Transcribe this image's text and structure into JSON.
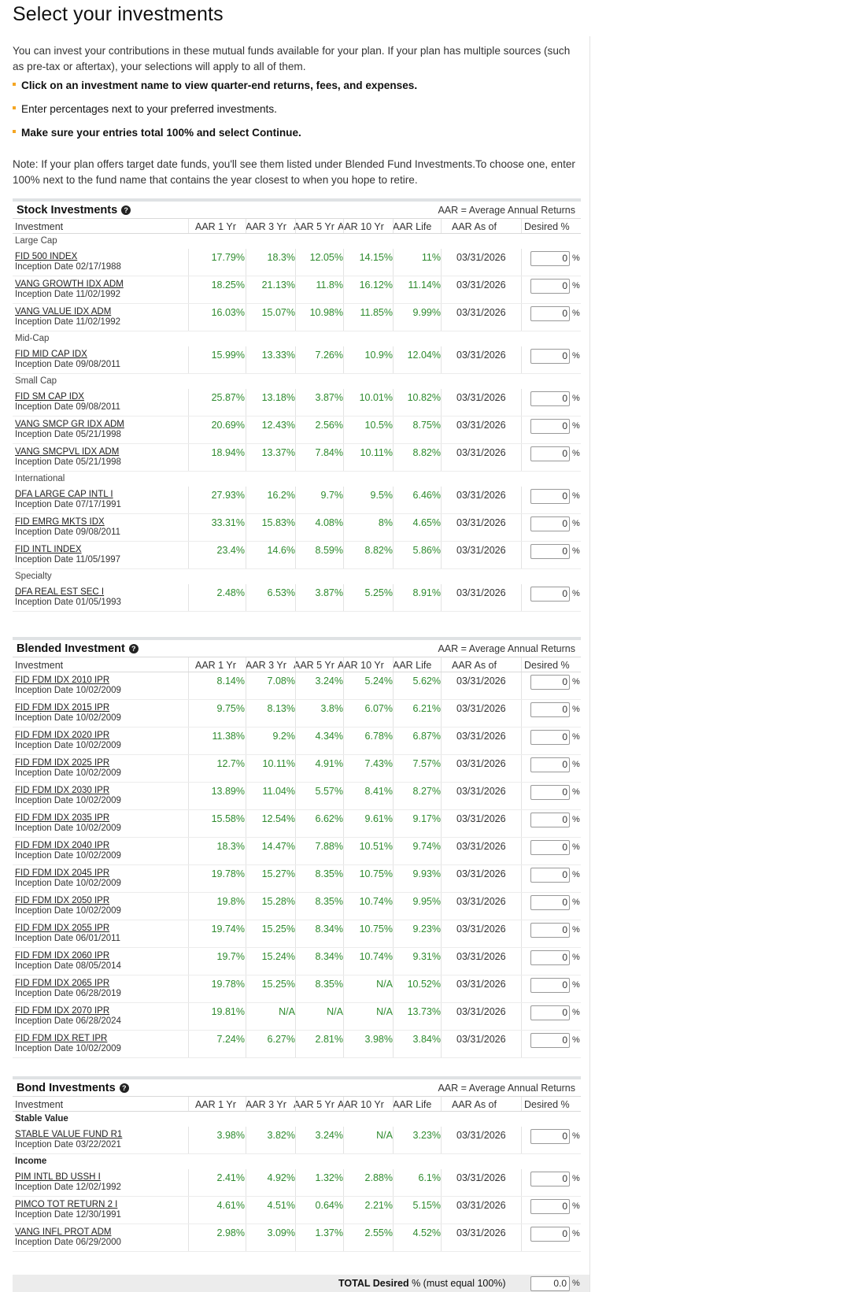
{
  "page_title": "Select your investments",
  "intro": "You can invest your contributions in these mutual funds available for your plan. If your plan has multiple sources (such as pre-tax or aftertax), your selections will apply to all of them.",
  "bullets": [
    "Click on an investment name to view quarter-end returns, fees, and expenses.",
    "Enter percentages next to your preferred investments.",
    "Make sure your entries total 100% and select Continue."
  ],
  "note": "Note: If your plan offers target date funds, you'll see them listed under Blended Fund Investments.To choose one, enter 100% next to the fund name that contains the year closest to when you hope to retire.",
  "aar_note": "AAR = Average Annual Returns",
  "columns": [
    "Investment",
    "AAR 1 Yr",
    "AAR 3 Yr",
    "AAR 5 Yr",
    "AAR 10 Yr",
    "AAR Life",
    "AAR As of",
    "Desired %"
  ],
  "percent_sign": "%",
  "sections": [
    {
      "title": "Stock Investments",
      "groups": [
        {
          "label": "Large Cap",
          "bold": false,
          "funds": [
            {
              "name": "FID 500 INDEX",
              "inception": "Inception Date 02/17/1988",
              "y1": "17.79%",
              "y3": "18.3%",
              "y5": "12.05%",
              "y10": "14.15%",
              "life": "11%",
              "asof": "03/31/2026",
              "desired": "0"
            },
            {
              "name": "VANG GROWTH IDX ADM",
              "inception": "Inception Date 11/02/1992",
              "y1": "18.25%",
              "y3": "21.13%",
              "y5": "11.8%",
              "y10": "16.12%",
              "life": "11.14%",
              "asof": "03/31/2026",
              "desired": "0"
            },
            {
              "name": "VANG VALUE IDX ADM",
              "inception": "Inception Date 11/02/1992",
              "y1": "16.03%",
              "y3": "15.07%",
              "y5": "10.98%",
              "y10": "11.85%",
              "life": "9.99%",
              "asof": "03/31/2026",
              "desired": "0"
            }
          ]
        },
        {
          "label": "Mid-Cap",
          "bold": false,
          "funds": [
            {
              "name": "FID MID CAP IDX",
              "inception": "Inception Date 09/08/2011",
              "y1": "15.99%",
              "y3": "13.33%",
              "y5": "7.26%",
              "y10": "10.9%",
              "life": "12.04%",
              "asof": "03/31/2026",
              "desired": "0"
            }
          ]
        },
        {
          "label": "Small Cap",
          "bold": false,
          "funds": [
            {
              "name": "FID SM CAP IDX",
              "inception": "Inception Date 09/08/2011",
              "y1": "25.87%",
              "y3": "13.18%",
              "y5": "3.87%",
              "y10": "10.01%",
              "life": "10.82%",
              "asof": "03/31/2026",
              "desired": "0"
            },
            {
              "name": "VANG SMCP GR IDX ADM",
              "inception": "Inception Date 05/21/1998",
              "y1": "20.69%",
              "y3": "12.43%",
              "y5": "2.56%",
              "y10": "10.5%",
              "life": "8.75%",
              "asof": "03/31/2026",
              "desired": "0"
            },
            {
              "name": "VANG SMCPVL IDX ADM",
              "inception": "Inception Date 05/21/1998",
              "y1": "18.94%",
              "y3": "13.37%",
              "y5": "7.84%",
              "y10": "10.11%",
              "life": "8.82%",
              "asof": "03/31/2026",
              "desired": "0"
            }
          ]
        },
        {
          "label": "International",
          "bold": false,
          "funds": [
            {
              "name": "DFA LARGE CAP INTL I",
              "inception": "Inception Date 07/17/1991",
              "y1": "27.93%",
              "y3": "16.2%",
              "y5": "9.7%",
              "y10": "9.5%",
              "life": "6.46%",
              "asof": "03/31/2026",
              "desired": "0"
            },
            {
              "name": "FID EMRG MKTS IDX",
              "inception": "Inception Date 09/08/2011",
              "y1": "33.31%",
              "y3": "15.83%",
              "y5": "4.08%",
              "y10": "8%",
              "life": "4.65%",
              "asof": "03/31/2026",
              "desired": "0"
            },
            {
              "name": "FID INTL INDEX",
              "inception": "Inception Date 11/05/1997",
              "y1": "23.4%",
              "y3": "14.6%",
              "y5": "8.59%",
              "y10": "8.82%",
              "life": "5.86%",
              "asof": "03/31/2026",
              "desired": "0"
            }
          ]
        },
        {
          "label": "Specialty",
          "bold": false,
          "funds": [
            {
              "name": "DFA REAL EST SEC I",
              "inception": "Inception Date 01/05/1993",
              "y1": "2.48%",
              "y3": "6.53%",
              "y5": "3.87%",
              "y10": "5.25%",
              "life": "8.91%",
              "asof": "03/31/2026",
              "desired": "0"
            }
          ]
        }
      ]
    },
    {
      "title": "Blended Investment",
      "groups": [
        {
          "label": "",
          "bold": false,
          "funds": [
            {
              "name": "FID FDM IDX 2010 IPR",
              "inception": "Inception Date 10/02/2009",
              "y1": "8.14%",
              "y3": "7.08%",
              "y5": "3.24%",
              "y10": "5.24%",
              "life": "5.62%",
              "asof": "03/31/2026",
              "desired": "0"
            },
            {
              "name": "FID FDM IDX 2015 IPR",
              "inception": "Inception Date 10/02/2009",
              "y1": "9.75%",
              "y3": "8.13%",
              "y5": "3.8%",
              "y10": "6.07%",
              "life": "6.21%",
              "asof": "03/31/2026",
              "desired": "0"
            },
            {
              "name": "FID FDM IDX 2020 IPR",
              "inception": "Inception Date 10/02/2009",
              "y1": "11.38%",
              "y3": "9.2%",
              "y5": "4.34%",
              "y10": "6.78%",
              "life": "6.87%",
              "asof": "03/31/2026",
              "desired": "0"
            },
            {
              "name": "FID FDM IDX 2025 IPR",
              "inception": "Inception Date 10/02/2009",
              "y1": "12.7%",
              "y3": "10.11%",
              "y5": "4.91%",
              "y10": "7.43%",
              "life": "7.57%",
              "asof": "03/31/2026",
              "desired": "0"
            },
            {
              "name": "FID FDM IDX 2030 IPR",
              "inception": "Inception Date 10/02/2009",
              "y1": "13.89%",
              "y3": "11.04%",
              "y5": "5.57%",
              "y10": "8.41%",
              "life": "8.27%",
              "asof": "03/31/2026",
              "desired": "0"
            },
            {
              "name": "FID FDM IDX 2035 IPR",
              "inception": "Inception Date 10/02/2009",
              "y1": "15.58%",
              "y3": "12.54%",
              "y5": "6.62%",
              "y10": "9.61%",
              "life": "9.17%",
              "asof": "03/31/2026",
              "desired": "0"
            },
            {
              "name": "FID FDM IDX 2040 IPR",
              "inception": "Inception Date 10/02/2009",
              "y1": "18.3%",
              "y3": "14.47%",
              "y5": "7.88%",
              "y10": "10.51%",
              "life": "9.74%",
              "asof": "03/31/2026",
              "desired": "0"
            },
            {
              "name": "FID FDM IDX 2045 IPR",
              "inception": "Inception Date 10/02/2009",
              "y1": "19.78%",
              "y3": "15.27%",
              "y5": "8.35%",
              "y10": "10.75%",
              "life": "9.93%",
              "asof": "03/31/2026",
              "desired": "0"
            },
            {
              "name": "FID FDM IDX 2050 IPR",
              "inception": "Inception Date 10/02/2009",
              "y1": "19.8%",
              "y3": "15.28%",
              "y5": "8.35%",
              "y10": "10.74%",
              "life": "9.95%",
              "asof": "03/31/2026",
              "desired": "0"
            },
            {
              "name": "FID FDM IDX 2055 IPR",
              "inception": "Inception Date 06/01/2011",
              "y1": "19.74%",
              "y3": "15.25%",
              "y5": "8.34%",
              "y10": "10.75%",
              "life": "9.23%",
              "asof": "03/31/2026",
              "desired": "0"
            },
            {
              "name": "FID FDM IDX 2060 IPR",
              "inception": "Inception Date 08/05/2014",
              "y1": "19.7%",
              "y3": "15.24%",
              "y5": "8.34%",
              "y10": "10.74%",
              "life": "9.31%",
              "asof": "03/31/2026",
              "desired": "0"
            },
            {
              "name": "FID FDM IDX 2065 IPR",
              "inception": "Inception Date 06/28/2019",
              "y1": "19.78%",
              "y3": "15.25%",
              "y5": "8.35%",
              "y10": "N/A",
              "life": "10.52%",
              "asof": "03/31/2026",
              "desired": "0"
            },
            {
              "name": "FID FDM IDX 2070 IPR",
              "inception": "Inception Date 06/28/2024",
              "y1": "19.81%",
              "y3": "N/A",
              "y5": "N/A",
              "y10": "N/A",
              "life": "13.73%",
              "asof": "03/31/2026",
              "desired": "0"
            },
            {
              "name": "FID FDM IDX RET IPR",
              "inception": "Inception Date 10/02/2009",
              "y1": "7.24%",
              "y3": "6.27%",
              "y5": "2.81%",
              "y10": "3.98%",
              "life": "3.84%",
              "asof": "03/31/2026",
              "desired": "0"
            }
          ]
        }
      ]
    },
    {
      "title": "Bond Investments",
      "groups": [
        {
          "label": "Stable Value",
          "bold": true,
          "funds": [
            {
              "name": "STABLE VALUE FUND R1",
              "inception": "Inception Date 03/22/2021",
              "y1": "3.98%",
              "y3": "3.82%",
              "y5": "3.24%",
              "y10": "N/A",
              "life": "3.23%",
              "asof": "03/31/2026",
              "desired": "0"
            }
          ]
        },
        {
          "label": "Income",
          "bold": true,
          "funds": [
            {
              "name": "PIM INTL BD USSH I",
              "inception": "Inception Date 12/02/1992",
              "y1": "2.41%",
              "y3": "4.92%",
              "y5": "1.32%",
              "y10": "2.88%",
              "life": "6.1%",
              "asof": "03/31/2026",
              "desired": "0"
            },
            {
              "name": "PIMCO TOT RETURN 2 I",
              "inception": "Inception Date 12/30/1991",
              "y1": "4.61%",
              "y3": "4.51%",
              "y5": "0.64%",
              "y10": "2.21%",
              "life": "5.15%",
              "asof": "03/31/2026",
              "desired": "0"
            },
            {
              "name": "VANG INFL PROT ADM",
              "inception": "Inception Date 06/29/2000",
              "y1": "2.98%",
              "y3": "3.09%",
              "y5": "1.37%",
              "y10": "2.55%",
              "life": "4.52%",
              "asof": "03/31/2026",
              "desired": "0"
            }
          ]
        }
      ]
    }
  ],
  "total": {
    "label_bold": "TOTAL Desired",
    "label_rest": " % (must equal 100%)",
    "value": "0.0"
  },
  "colors": {
    "positive": "#2e8b2e",
    "accent": "#f5a623"
  },
  "icons": {
    "section_help": "question-circle-icon",
    "bullet": "square-bullet-icon"
  }
}
